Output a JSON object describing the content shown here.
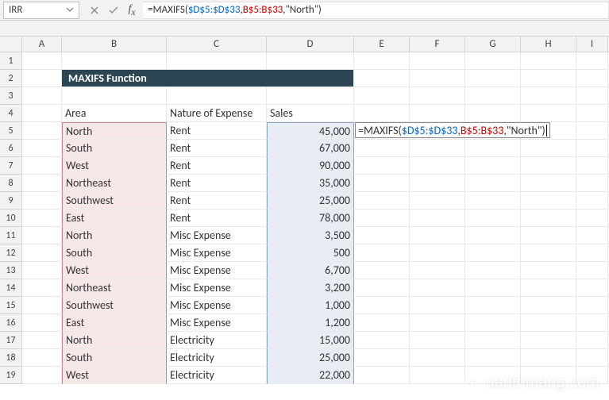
{
  "namebox": "IRR",
  "formula_parts": {
    "prefix": "=MAXIFS( ",
    "ref1": "$D$5:$D$33",
    "sep1": ", ",
    "ref2": "B$5:B$33",
    "sep2": ", ",
    "str": "\"North\"",
    "suffix": " )"
  },
  "columns": [
    "A",
    "B",
    "C",
    "D",
    "E",
    "F",
    "G",
    "H",
    "I"
  ],
  "title": "MAXIFS Function",
  "headers": {
    "area": "Area",
    "nature": "Nature of Expense",
    "sales": "Sales"
  },
  "rows": [
    {
      "n": 1
    },
    {
      "n": 2,
      "title": true
    },
    {
      "n": 3
    },
    {
      "n": 4,
      "header": true
    },
    {
      "n": 5,
      "b": "North",
      "c": "Rent",
      "d": "45,000",
      "editor": true,
      "first": true
    },
    {
      "n": 6,
      "b": "South",
      "c": "Rent",
      "d": "67,000"
    },
    {
      "n": 7,
      "b": "West",
      "c": "Rent",
      "d": "90,000"
    },
    {
      "n": 8,
      "b": "Northeast",
      "c": "Rent",
      "d": "35,000"
    },
    {
      "n": 9,
      "b": "Southwest",
      "c": "Rent",
      "d": "25,000"
    },
    {
      "n": 10,
      "b": "East",
      "c": "Rent",
      "d": "78,000"
    },
    {
      "n": 11,
      "b": "North",
      "c": "Misc Expense",
      "d": "3,500"
    },
    {
      "n": 12,
      "b": "South",
      "c": "Misc Expense",
      "d": "500"
    },
    {
      "n": 13,
      "b": "West",
      "c": "Misc Expense",
      "d": "6,700"
    },
    {
      "n": 14,
      "b": "Northeast",
      "c": "Misc Expense",
      "d": "3,200"
    },
    {
      "n": 15,
      "b": "Southwest",
      "c": "Misc Expense",
      "d": "1,000"
    },
    {
      "n": 16,
      "b": "East",
      "c": "Misc Expense",
      "d": "1,200"
    },
    {
      "n": 17,
      "b": "North",
      "c": "Electricity",
      "d": "15,000"
    },
    {
      "n": 18,
      "b": "South",
      "c": "Electricity",
      "d": "25,000"
    },
    {
      "n": 19,
      "b": "West",
      "c": "Electricity",
      "d": "22,000"
    }
  ],
  "watermark": "uantrimang.com"
}
